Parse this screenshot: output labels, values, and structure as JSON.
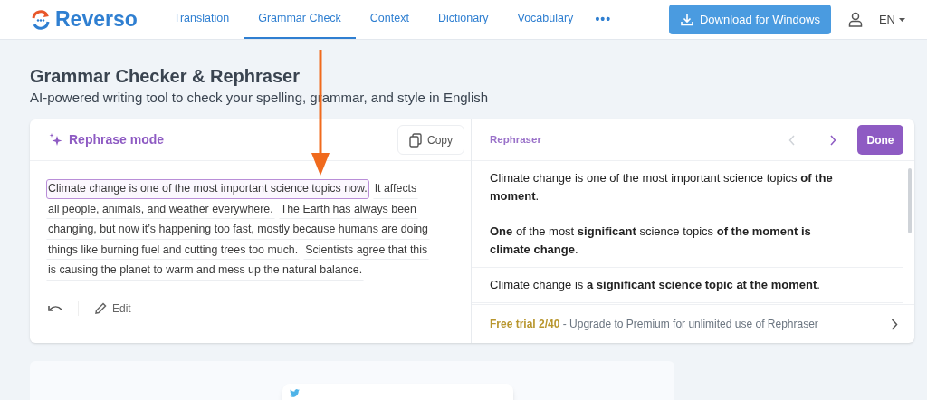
{
  "nav": {
    "logo": "Reverso",
    "links": [
      {
        "label": "Translation",
        "selected": false
      },
      {
        "label": "Grammar Check",
        "selected": true
      },
      {
        "label": "Context",
        "selected": false
      },
      {
        "label": "Dictionary",
        "selected": false
      },
      {
        "label": "Vocabulary",
        "selected": false
      }
    ],
    "more": "•••",
    "download": "Download for Windows",
    "language": "EN"
  },
  "header": {
    "title": "Grammar Checker & Rephraser",
    "subtitle": "AI-powered writing tool to check your spelling, grammar, and style in English"
  },
  "editor": {
    "mode": "Rephrase mode",
    "copy": "Copy",
    "lines": [
      [
        {
          "text": "Climate change is one of the most important science topics now.",
          "selected": true
        },
        {
          "text": "It affects",
          "selected": false
        }
      ],
      [
        {
          "text": "all people, animals, and weather everywhere.",
          "selected": false
        },
        {
          "text": "The Earth has always been",
          "selected": false
        }
      ],
      [
        {
          "text": "changing, but now it’s happening too fast, mostly because humans are doing",
          "selected": false
        }
      ],
      [
        {
          "text": "things like burning fuel and cutting trees too much.",
          "selected": false
        },
        {
          "text": "Scientists agree that this",
          "selected": false
        }
      ],
      [
        {
          "text": "is causing the planet to warm and mess up the natural balance.",
          "selected": false
        }
      ]
    ],
    "edit": "Edit"
  },
  "rephraser": {
    "title": "Rephraser",
    "prev_disabled": true,
    "next_disabled": false,
    "done": "Done",
    "suggestions": [
      "Climate change is one of the most important science topics **of the moment**.",
      "**One** of the most **significant** science topics **of the moment is climate change**.",
      "Climate change is **a significant science topic at the moment**."
    ],
    "trial": {
      "badge": "Free trial 2/40",
      "text": " - Upgrade to Premium for unlimited use of Rephraser"
    }
  },
  "annotation": {
    "kind": "arrow"
  }
}
